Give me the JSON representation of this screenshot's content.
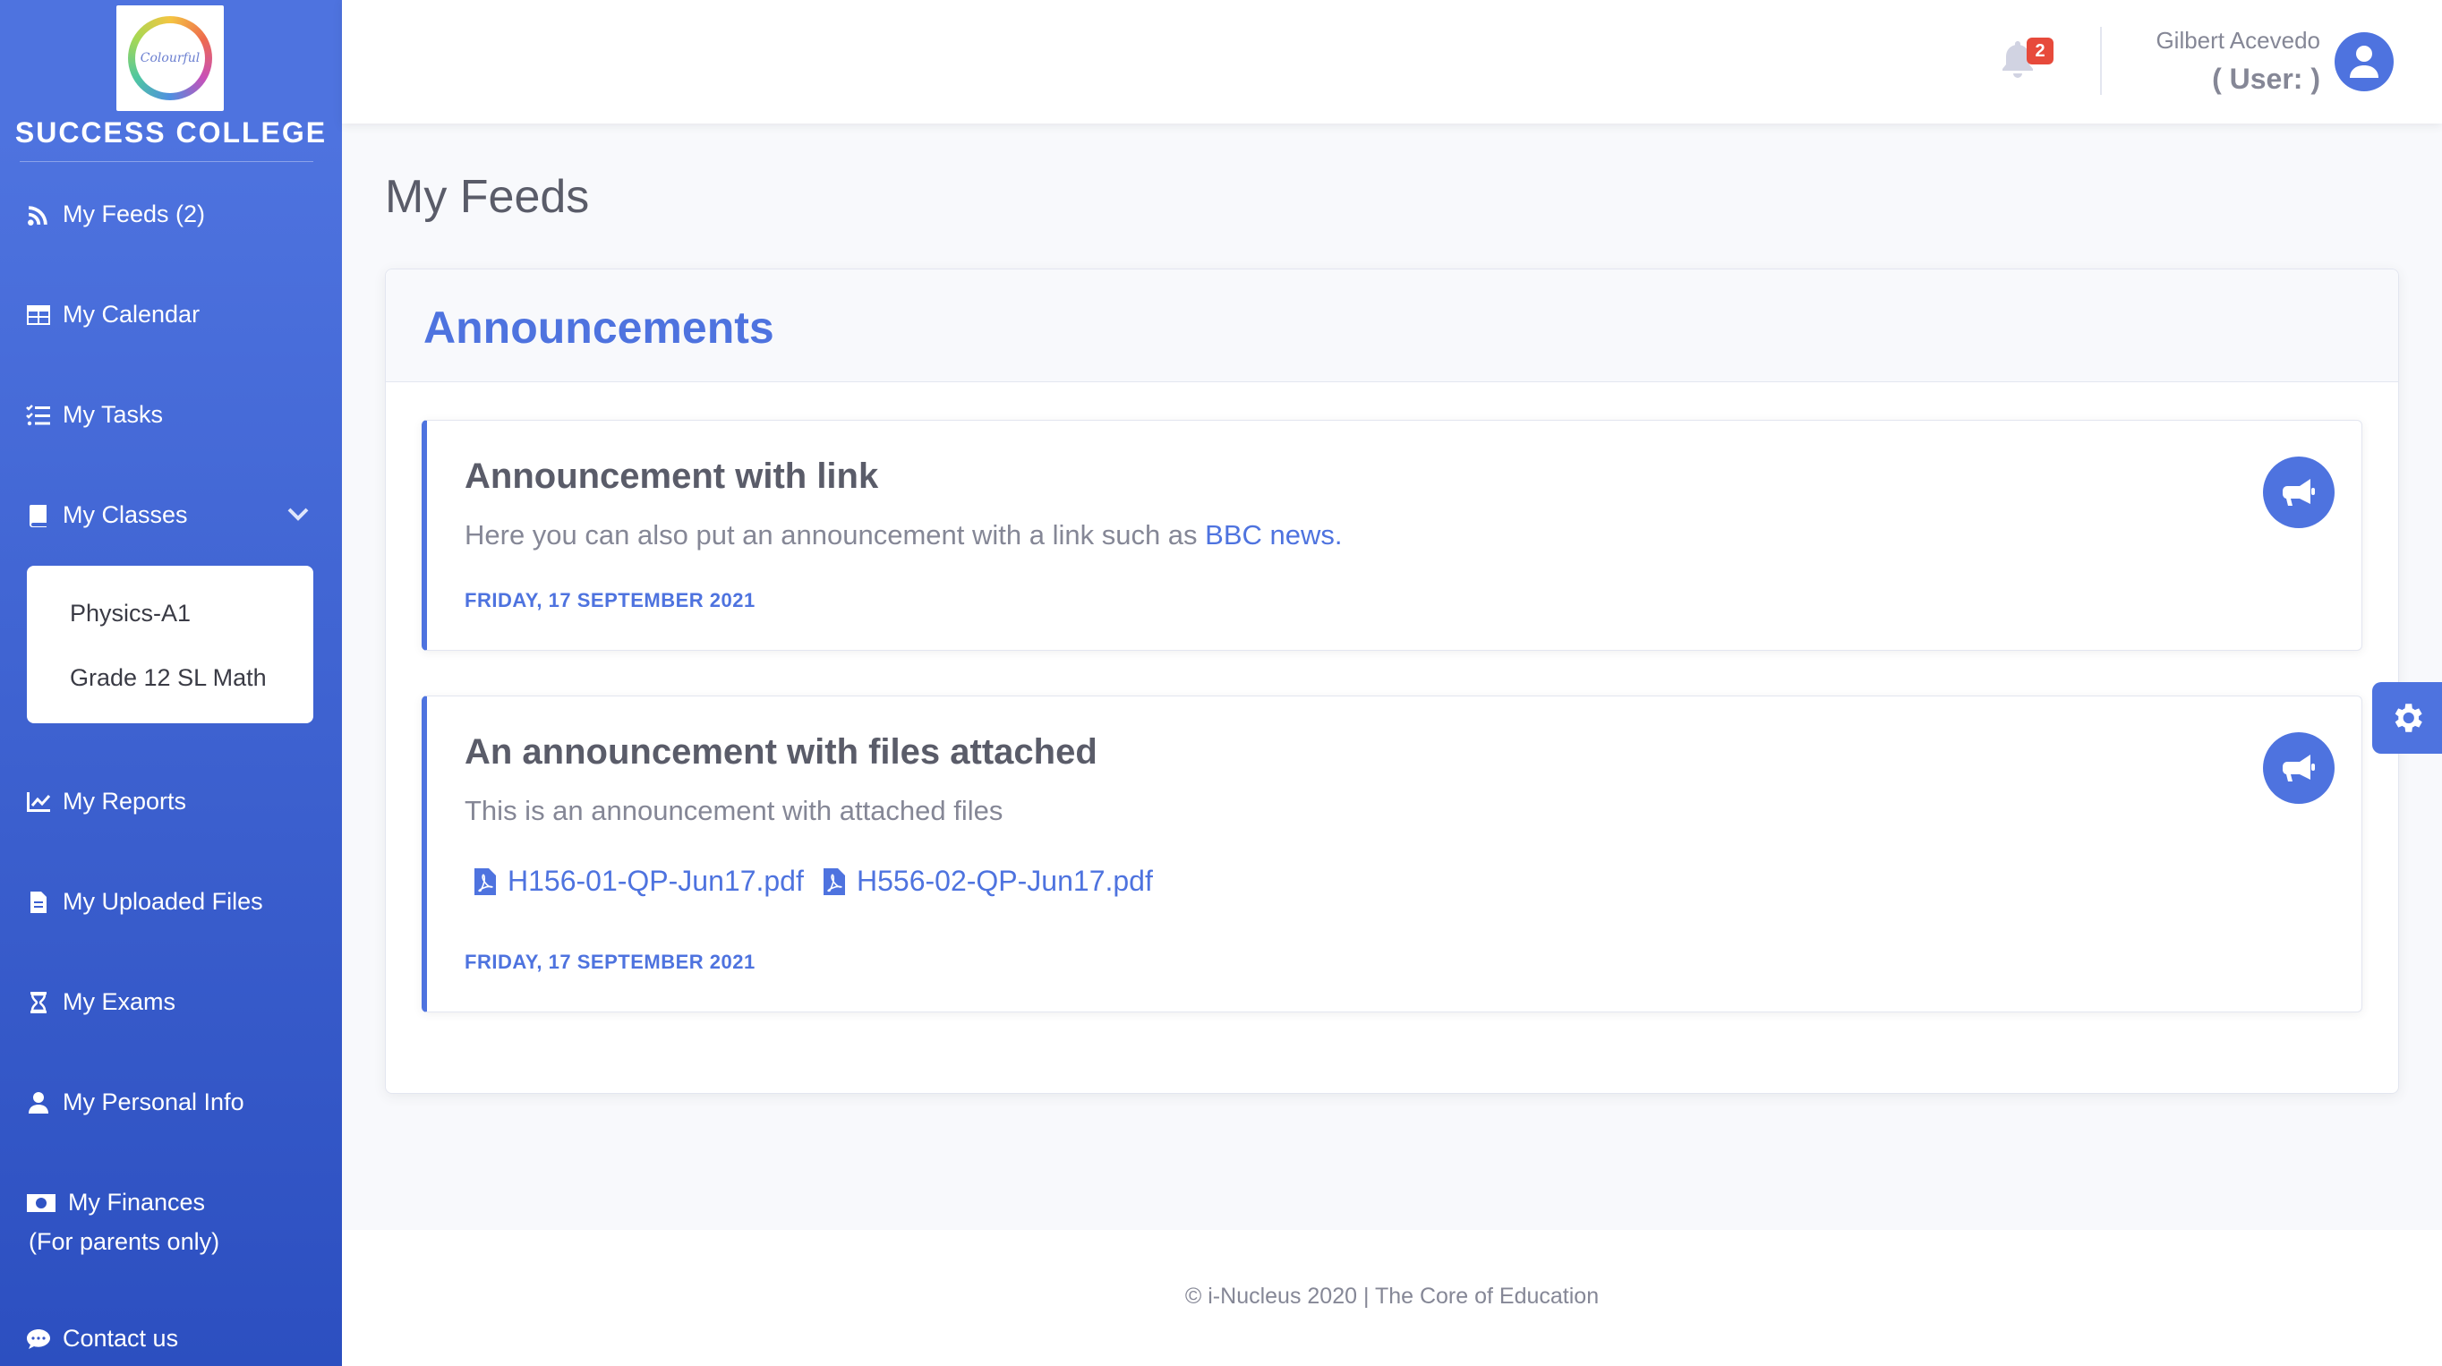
{
  "sidebar": {
    "brand": "SUCCESS COLLEGE",
    "logo_text": "Colourful",
    "items": [
      {
        "label": "My Feeds (2)",
        "icon": "rss-icon"
      },
      {
        "label": "My Calendar",
        "icon": "calendar-table-icon"
      },
      {
        "label": "My Tasks",
        "icon": "task-list-icon"
      },
      {
        "label": "My Classes",
        "icon": "book-icon"
      },
      {
        "label": "My Reports",
        "icon": "chart-line-icon"
      },
      {
        "label": "My Uploaded Files",
        "icon": "file-icon"
      },
      {
        "label": "My Exams",
        "icon": "hourglass-icon"
      },
      {
        "label": "My Personal Info",
        "icon": "user-icon"
      },
      {
        "label": "My Finances",
        "icon": "money-bill-icon"
      },
      {
        "label": "Contact us",
        "icon": "comment-icon"
      }
    ],
    "finances_sub": "(For parents only)",
    "classes": [
      "Physics-A1",
      "Grade 12 SL Math"
    ]
  },
  "topbar": {
    "notification_count": "2",
    "user_name": "Gilbert Acevedo",
    "user_role": "( User: )"
  },
  "main": {
    "page_title": "My Feeds",
    "card_title": "Announcements",
    "announcements": [
      {
        "title": "Announcement with link",
        "body": "Here you can also put an announcement with a link such as ",
        "link_text": "BBC news.",
        "date": "FRIDAY, 17 SEPTEMBER 2021"
      },
      {
        "title": "An announcement with files attached",
        "body": "This is an announcement with attached files",
        "files": [
          "H156-01-QP-Jun17.pdf",
          "H556-02-QP-Jun17.pdf"
        ],
        "date": "FRIDAY, 17 SEPTEMBER 2021"
      }
    ]
  },
  "footer": {
    "text": "© i-Nucleus 2020 | The Core of Education"
  },
  "colors": {
    "primary": "#4e73df",
    "sidebar_dark": "#2c4fc0",
    "badge": "#e74a3b"
  }
}
